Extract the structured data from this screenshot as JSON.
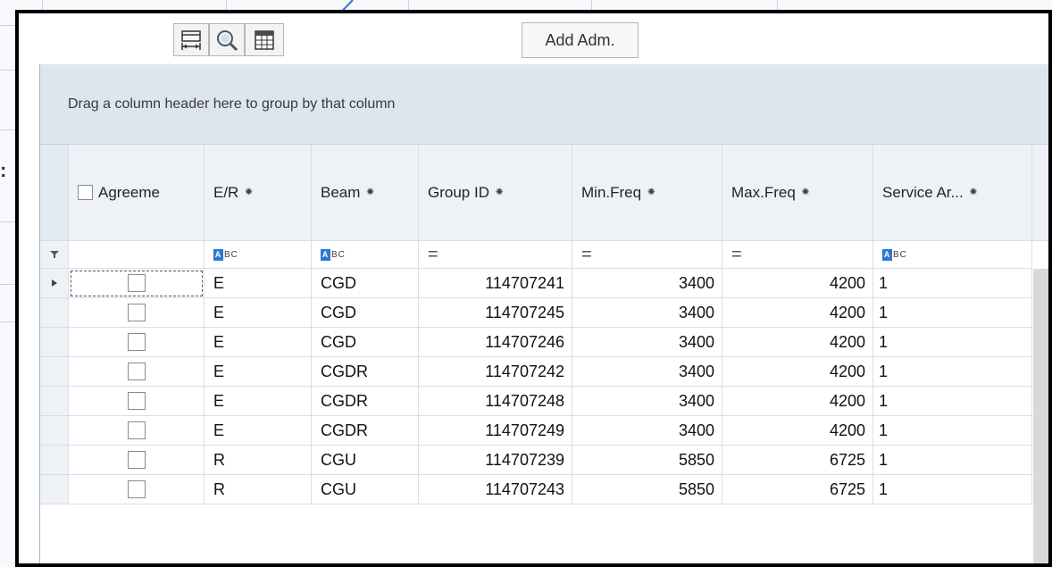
{
  "toolbar": {
    "fit_columns_icon": "fit-columns-icon",
    "search_icon": "magnifier-icon",
    "column_chooser_icon": "column-chooser-icon",
    "add_adm_label": "Add Adm."
  },
  "grid": {
    "group_panel_text": "Drag a column header here to group by that column",
    "columns": [
      {
        "key": "agreement",
        "label": "Agreeme"
      },
      {
        "key": "er",
        "label": "E/R"
      },
      {
        "key": "beam",
        "label": "Beam"
      },
      {
        "key": "group_id",
        "label": "Group ID"
      },
      {
        "key": "min_freq",
        "label": "Min.Freq"
      },
      {
        "key": "max_freq",
        "label": "Max.Freq"
      },
      {
        "key": "service_area",
        "label": "Service Ar..."
      }
    ],
    "filter_row": {
      "er": "ABC",
      "beam": "ABC",
      "group_id": "=",
      "min_freq": "=",
      "max_freq": "=",
      "service_area": "ABC"
    },
    "rows": [
      {
        "er": "E",
        "beam": "CGD",
        "group_id": "114707241",
        "min_freq": "3400",
        "max_freq": "4200",
        "service_area": "1"
      },
      {
        "er": "E",
        "beam": "CGD",
        "group_id": "114707245",
        "min_freq": "3400",
        "max_freq": "4200",
        "service_area": "1"
      },
      {
        "er": "E",
        "beam": "CGD",
        "group_id": "114707246",
        "min_freq": "3400",
        "max_freq": "4200",
        "service_area": "1"
      },
      {
        "er": "E",
        "beam": "CGDR",
        "group_id": "114707242",
        "min_freq": "3400",
        "max_freq": "4200",
        "service_area": "1"
      },
      {
        "er": "E",
        "beam": "CGDR",
        "group_id": "114707248",
        "min_freq": "3400",
        "max_freq": "4200",
        "service_area": "1"
      },
      {
        "er": "E",
        "beam": "CGDR",
        "group_id": "114707249",
        "min_freq": "3400",
        "max_freq": "4200",
        "service_area": "1"
      },
      {
        "er": "R",
        "beam": "CGU",
        "group_id": "114707239",
        "min_freq": "5850",
        "max_freq": "6725",
        "service_area": "1"
      },
      {
        "er": "R",
        "beam": "CGU",
        "group_id": "114707243",
        "min_freq": "5850",
        "max_freq": "6725",
        "service_area": "1"
      }
    ]
  },
  "background": {
    "colon_fragment": ":"
  },
  "colors": {
    "frame_border": "#000000",
    "group_panel_bg": "#dde5ef",
    "header_bg": "#eef2f7",
    "grid_line": "#d6deea",
    "abc_badge": "#2a79d6",
    "pointer_line": "#2a79d6"
  }
}
